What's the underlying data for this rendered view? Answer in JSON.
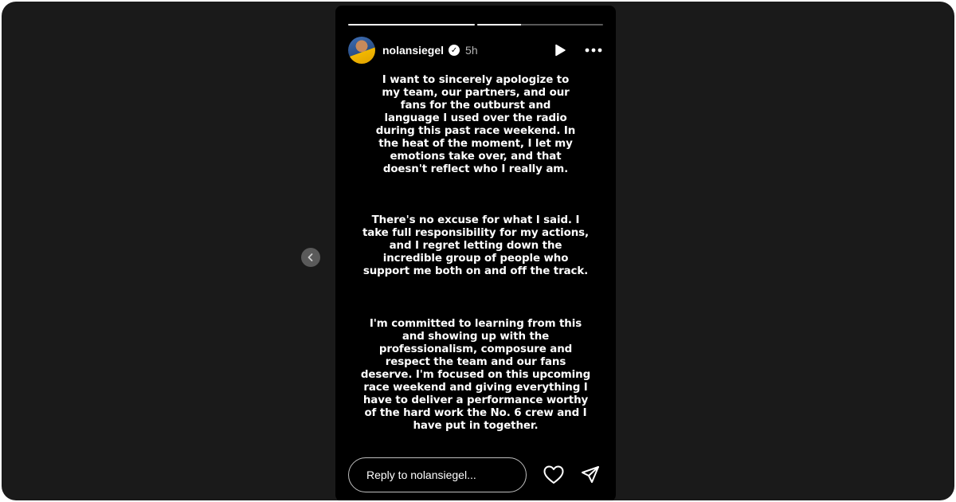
{
  "story": {
    "progress": [
      1.0,
      0.35
    ],
    "user": {
      "username": "nolansiegel",
      "verified_icon": "verified-badge-icon",
      "time_ago": "5h"
    },
    "header_icons": [
      "play-icon",
      "more-icon"
    ],
    "paragraphs": [
      "I want to sincerely apologize to\nmy team, our partners, and our\nfans for the outburst and\nlanguage I used over the radio\nduring this past race weekend. In\nthe heat of the moment, I let my\nemotions take over, and that\ndoesn't reflect who I really am.",
      "There's no excuse for what I said. I\ntake full responsibility for my actions,\nand I regret letting down the\nincredible group of people who\nsupport me both on and off the track.",
      "I'm committed to learning from this\nand showing up with the\nprofessionalism, composure and\nrespect the team and our fans\ndeserve. I'm focused on this upcoming\nrace weekend and giving everything I\nhave to deliver a performance worthy\nof the hard work the No. 6 crew and I\nhave put in together."
    ],
    "reply": {
      "placeholder": "Reply to nolansiegel..."
    },
    "footer_icons": [
      "heart-icon",
      "send-icon"
    ]
  },
  "navigation": {
    "prev_icon": "chevron-left-icon"
  },
  "colors": {
    "frame_bg": "#1a1a1a",
    "story_bg": "#000000",
    "text": "#ffffff"
  }
}
